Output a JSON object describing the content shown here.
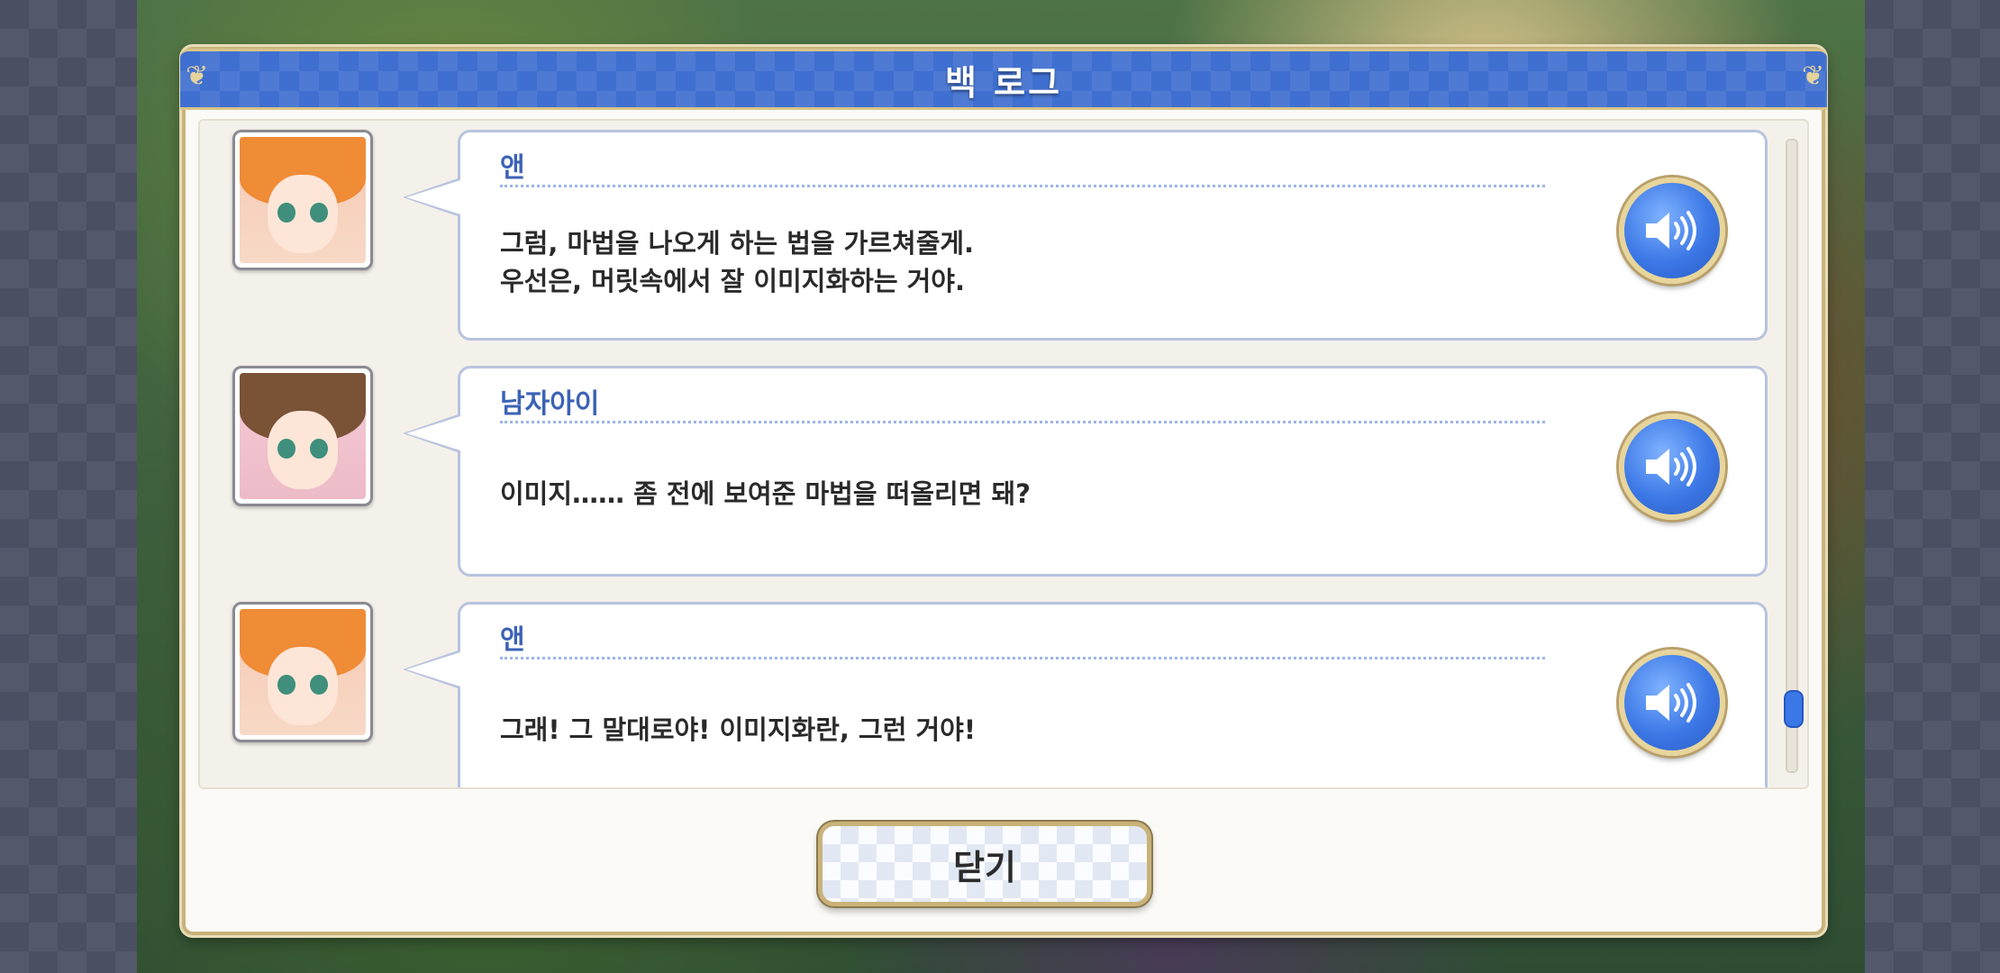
{
  "dialog": {
    "title": "백 로그",
    "close_label": "닫기"
  },
  "entries": [
    {
      "speaker": "앤",
      "lines": [
        "그럼, 마법을 나오게 하는 법을 가르쳐줄게.",
        "우선은, 머릿속에서 잘 이미지화하는 거야."
      ],
      "avatar": "anne"
    },
    {
      "speaker": "남자아이",
      "lines": [
        "이미지…… 좀 전에 보여준 마법을 떠올리면 돼?"
      ],
      "avatar": "boy"
    },
    {
      "speaker": "앤",
      "lines": [
        "그래! 그 말대로야! 이미지화란, 그런 거야!"
      ],
      "avatar": "anne"
    }
  ],
  "icons": {
    "voice": "speaker-volume-icon"
  },
  "colors": {
    "header": "#3f6fd0",
    "speaker": "#3c62b5",
    "accent_gold": "#c9b37a"
  }
}
